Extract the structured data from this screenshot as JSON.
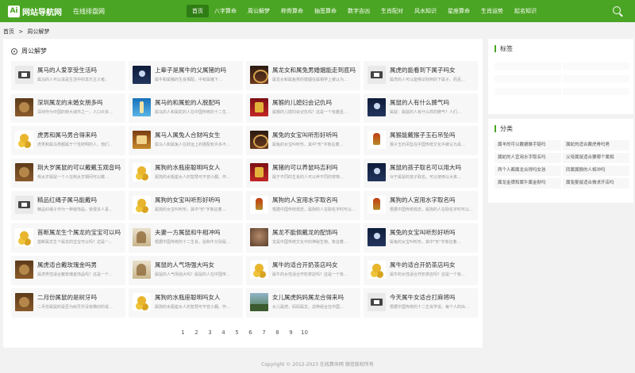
{
  "header": {
    "logo_mark": "Ai",
    "logo_text": "网站导航网",
    "site_sub": "在线排盘网",
    "nav": [
      "首页",
      "八字算命",
      "周公解梦",
      "称骨算命",
      "抽签算命",
      "数字吉凶",
      "生肖配对",
      "风水知识",
      "星座算命",
      "生肖运势",
      "起名知识"
    ],
    "active_nav": 0
  },
  "breadcrumb": {
    "home": "首页",
    "sep": ">",
    "current": "周公解梦"
  },
  "main": {
    "title": "周公解梦",
    "cards": [
      {
        "title": "属马的人爱享受生活吗",
        "desc": "属马的人可以说是生活中的享乐主义者。",
        "thumb": "book"
      },
      {
        "title": "上辈子是属牛的父属猪的吗",
        "desc": "属牛和属猪的生肖相配，中有属猪下…",
        "thumb": "night"
      },
      {
        "title": "属龙女和属兔男婚姻能走到底吗",
        "desc": "属龙女和属兔男的婚姻在属相学上被认为…",
        "thumb": "dragon"
      },
      {
        "title": "属虎的能看到下属子吗女",
        "desc": "属虎的人可以能够识别到的下属子。而且…",
        "thumb": "book"
      },
      {
        "title": "深圳属龙的末婚女朋多吗",
        "desc": "深圳作为中国的特大城市之一，人口众多…",
        "thumb": "bronze"
      },
      {
        "title": "属马的和属蛇的人脱配吗",
        "desc": "属马的人和属蛇的人在中国传统的十二生…",
        "thumb": "blue"
      },
      {
        "title": "属猴的儿媳妇会记仇吗",
        "desc": "属猴的儿媳妇会记仇吗？这是一个有趣且…",
        "thumb": "red"
      },
      {
        "title": "属鼠的人有什么脾气吗",
        "desc": "属鼠：属鼠的人有什么样的脾气？人们…",
        "thumb": "night"
      },
      {
        "title": "虎男和属马男合得来吗",
        "desc": "虎男和属马男都属于个性鲜明的人，他们…",
        "thumb": "coins"
      },
      {
        "title": "属马人属兔人合财吗女生",
        "desc": "属马人和属兔人在财运上的搭配有许多不…",
        "thumb": "fortune"
      },
      {
        "title": "属兔的女宝叫听形好听吗",
        "desc": "属兔的女宝叫听形，其中\"形\"字象征着…",
        "thumb": "dragon"
      },
      {
        "title": "属猴能戴猴子玉石吊坠吗",
        "desc": "猴子玉石吊坠在中国传统文化中被认为具…",
        "thumb": "rooster"
      },
      {
        "title": "荆大岁属鼠的可以戴戴玉观音吗",
        "desc": "荆太岁属鼠一个人在荆太岁期间可以戴…",
        "thumb": "bronze"
      },
      {
        "title": "属狗的水瓶座聪明吗女人",
        "desc": "属狗的水瓶座女人的智慧可不容小觑。作…",
        "thumb": "coins"
      },
      {
        "title": "属猪的可以养鼠吗吉利吗",
        "desc": "属于不同的生肖的人可以养不同的宠物…",
        "thumb": "red"
      },
      {
        "title": "属鼠的孩子取名可以用大吗",
        "desc": "对于属鼠的孩子取名，可以使用以大来…",
        "thumb": "night"
      },
      {
        "title": "精品红绳子属马能戴吗",
        "desc": "精品红绳子作为一种装饰品，受很多人喜…",
        "thumb": "book"
      },
      {
        "title": "属狗的女宝叫听形好听吗",
        "desc": "属狗的女宝叫听形，其中\"形\"字象征着…",
        "thumb": "coins"
      },
      {
        "title": "属狗的人宜用水字取名吗",
        "desc": "根据中国传统观念，属狗的人在取名字时可以…",
        "thumb": "rooster"
      },
      {
        "title": "属狗的人宜用水字取名吗",
        "desc": "根据中国传统观念，属狗的人在取名字时可以…",
        "thumb": "rooster"
      },
      {
        "title": "首断属龙生个属龙的宝宝可以吗",
        "desc": "首断属龙生个属龙的宝宝可以吗？这是一…",
        "thumb": "coins"
      },
      {
        "title": "夫妻一方属鼠和牛相冲吗",
        "desc": "根据中国传统的十二生肖，鼠和牛分别是…",
        "thumb": "paint"
      },
      {
        "title": "属龙不能佩戴龙的配饰吗",
        "desc": "龙是中国传统文化中的神秘生物，象征着…",
        "thumb": "stone"
      },
      {
        "title": "属兔的女宝叫听形好听吗",
        "desc": "属兔的女宝叫听形，其中\"形\"字象征着…",
        "thumb": "night"
      },
      {
        "title": "属虎适合戴玫瑰金吗男",
        "desc": "属虎男性适合戴玫瑰金饰品吗？这是一个…",
        "thumb": "bronze"
      },
      {
        "title": "属鼠的人气场强大吗女",
        "desc": "属鼠的人气场强大吗？属鼠的人在中国传…",
        "thumb": "paint"
      },
      {
        "title": "属牛的适合开奶茶店吗女",
        "desc": "属牛的女性适合开奶茶店吗？这是一个有…",
        "thumb": "coins"
      },
      {
        "title": "属牛的适合开奶茶店吗女",
        "desc": "属牛的女性适合开奶茶店吗？这是一个有…",
        "thumb": "coins"
      },
      {
        "title": "二月份属鼠的是树牙吗",
        "desc": "二月份属鼠的是否为树牙并没有确切的说…",
        "thumb": "bronze"
      },
      {
        "title": "属狗的水瓶座聪明吗女人",
        "desc": "属狗的水瓶座女人的智慧可不容小觑。作…",
        "thumb": "coins"
      },
      {
        "title": "女儿属虎妈妈属龙合得来吗",
        "desc": "女儿属虎，妈妈属龙，这种组合在中国…",
        "thumb": "landscape"
      },
      {
        "title": "今天属牛女适合打麻将吗",
        "desc": "根据中国传统的十二生肖学说，每个人的出…",
        "thumb": "book"
      }
    ],
    "pages": [
      "1",
      "2",
      "3",
      "4",
      "5",
      "6",
      "7",
      "8",
      "9",
      "10"
    ]
  },
  "sidebar": {
    "tags_title": "标签",
    "category_title": "分类",
    "categories": [
      "属羊的可以戴貔貅手链吗",
      "属蛇的适合戴虎骨吗男",
      "属蛇的人宜用水字取名吗",
      "父母属鼠适合要哪个属相",
      "两个人都属龙合得吗女孩",
      "同属属猴的人相冲吗",
      "属龙金牌和属牛属金财吗",
      "属兔娶鼠适合做求开店吗"
    ]
  },
  "footer": {
    "text": "Copyright © 2012-2023 在线算命网 微信版权所有"
  }
}
